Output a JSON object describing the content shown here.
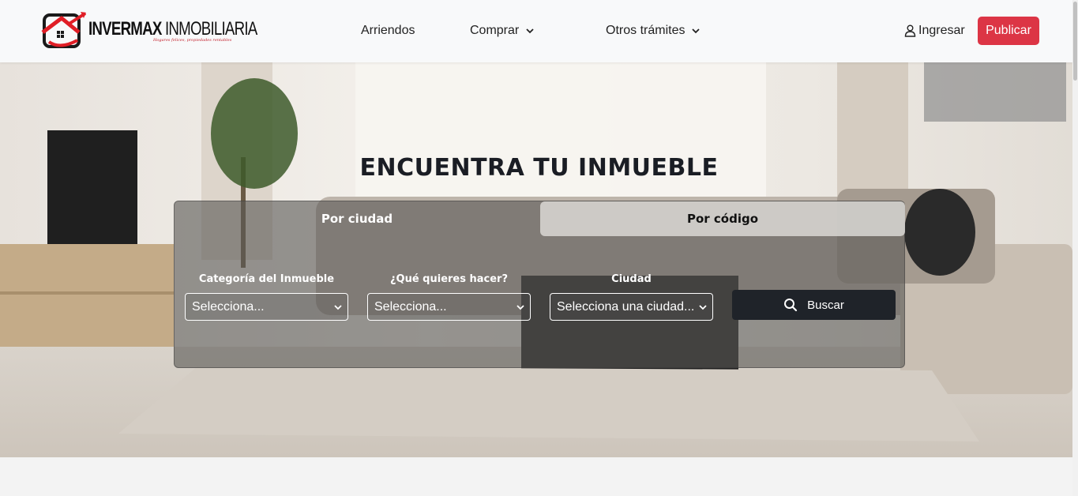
{
  "header": {
    "brand_bold": "INVERMAX",
    "brand_light": "INMOBILIARIA",
    "tagline": "Hogares felices, propiedades rentables",
    "nav": [
      {
        "label": "Arriendos",
        "has_dropdown": false
      },
      {
        "label": "Comprar",
        "has_dropdown": true
      },
      {
        "label": "Otros trámites",
        "has_dropdown": true
      }
    ],
    "login_label": "Ingresar",
    "publish_label": "Publicar",
    "icons": {
      "login": "user-icon",
      "dropdown": "chevron-down-icon"
    }
  },
  "hero": {
    "title": "ENCUENTRA TU INMUEBLE",
    "tabs": [
      {
        "label": "Por ciudad",
        "active": true
      },
      {
        "label": "Por código",
        "active": false
      }
    ],
    "fields": [
      {
        "label": "Categoría del Inmueble",
        "value": "Selecciona..."
      },
      {
        "label": "¿Qué quieres hacer?",
        "value": "Selecciona..."
      },
      {
        "label": "Ciudad",
        "value": "Selecciona una ciudad..."
      }
    ],
    "search_label": "Buscar",
    "search_icon": "search-icon"
  },
  "colors": {
    "accent": "#dc3545",
    "dark": "#1f2329",
    "header_bg": "#f8f9fa"
  }
}
